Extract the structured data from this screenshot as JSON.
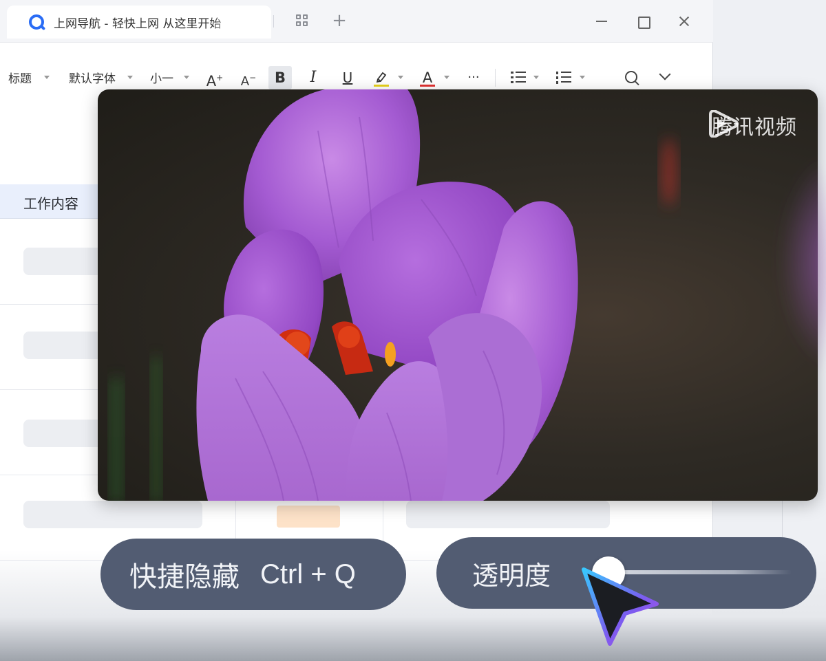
{
  "browser": {
    "tab_title": "上网导航 - 轻快上网 从这里开始",
    "icons": [
      "browser-logo-icon",
      "apps-icon",
      "new-tab-icon",
      "minimize-icon",
      "maximize-icon",
      "close-icon"
    ]
  },
  "toolbar": {
    "heading": "标题",
    "font_family": "默认字体",
    "font_size": "小一",
    "increase_font": "A",
    "decrease_font": "A",
    "bold": "B",
    "italic": "I",
    "underline": "U",
    "font_color": "A",
    "more": "···"
  },
  "table": {
    "column_header": "工作内容"
  },
  "video": {
    "watermark": "腾讯视频"
  },
  "hide_pill": {
    "label": "快捷隐藏",
    "shortcut": "Ctrl + Q"
  },
  "opacity_pill": {
    "label": "透明度",
    "value": 0.05
  },
  "colors": {
    "pill": "#525c72",
    "accent": "#2a6cf5",
    "cursor_outline": "#8a4fe0",
    "flower": "#a560d0"
  }
}
